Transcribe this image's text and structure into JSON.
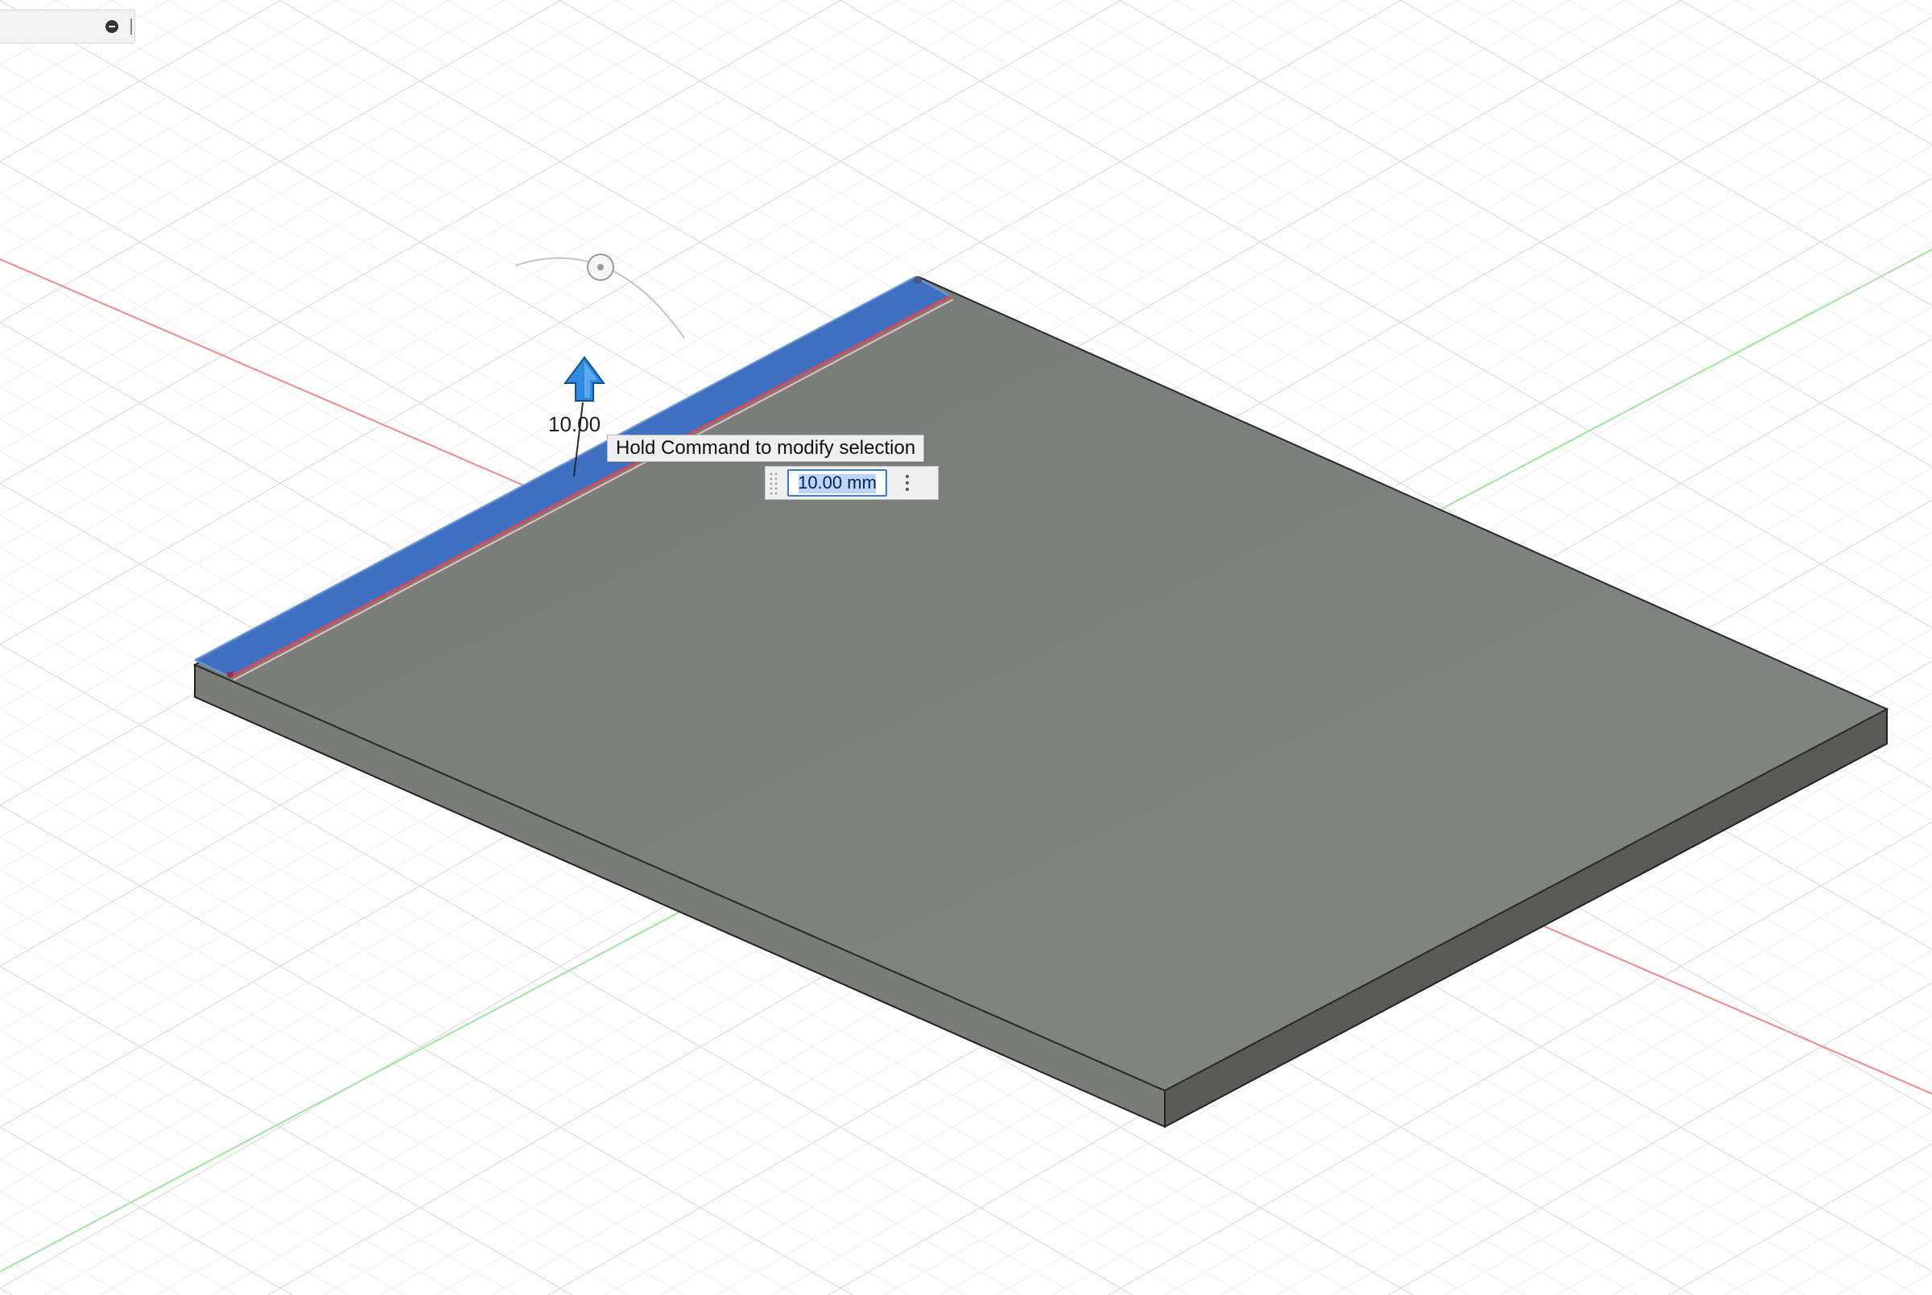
{
  "viewport": {
    "tooltip_text": "Hold Command to modify selection",
    "dimension_label": "10.00",
    "input": {
      "value": "10.00 mm",
      "unit": "mm"
    },
    "colors": {
      "background": "#ffffff",
      "grid_minor": "#eeeeee",
      "grid_major": "#dddddd",
      "x_axis": "#f08080",
      "y_axis": "#8fe08f",
      "plate_top": "#7c8480",
      "plate_side_front": "#7c7e78",
      "plate_side_right": "#5b5c57",
      "selected_face": "#3e70c4",
      "selected_edge": "#d44a5a"
    }
  },
  "top_panel": {
    "icons": [
      "collapse-icon",
      "grip-icon"
    ]
  },
  "manipulator": {
    "arrow_icon": "up-arrow-icon",
    "rotate_icon": "rotate-handle-icon"
  }
}
